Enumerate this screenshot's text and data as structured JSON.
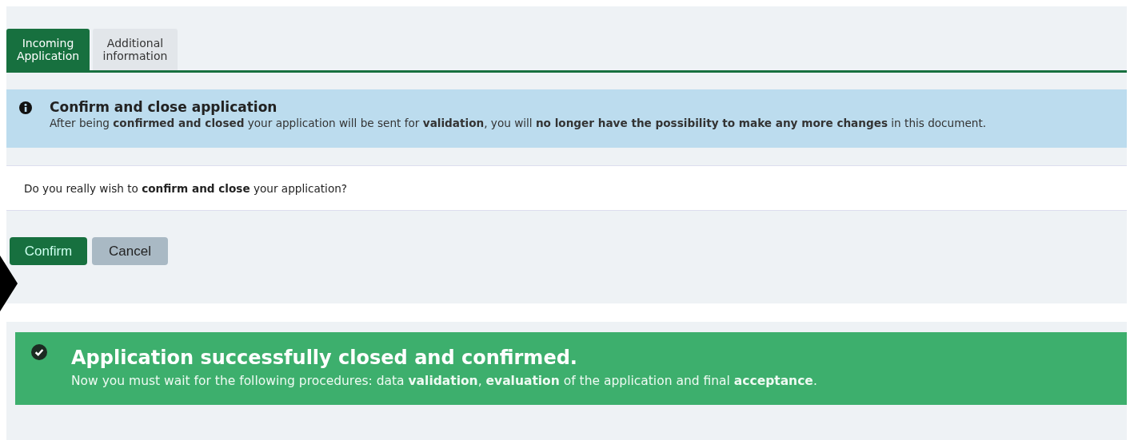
{
  "tabs": [
    {
      "label": "Incoming Application",
      "selected": true
    },
    {
      "label": "Additional information",
      "selected": false
    }
  ],
  "info": {
    "title": "Confirm and close application",
    "text": "After being **confirmed and closed** your application will be sent for **validation**, you will **no longer have the possibility to make any more changes** in this document."
  },
  "question": "Do you really wish to **confirm and close** your application?",
  "buttons": [
    {
      "label": "Confirm",
      "kind": "primary"
    },
    {
      "label": "Cancel",
      "kind": "secondary"
    }
  ],
  "success": {
    "title": "Application successfully closed and confirmed.",
    "text": "Now you must wait for the following procedures: data **validation**, **evaluation** of the application and final **acceptance**."
  }
}
